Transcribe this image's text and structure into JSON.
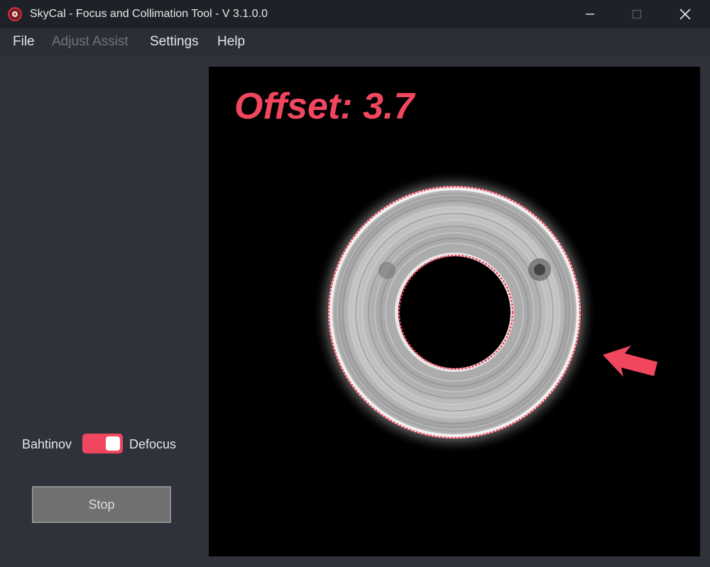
{
  "window": {
    "title": "SkyCal - Focus and Collimation Tool - V 3.1.0.0",
    "controls": {
      "minimize_icon": "minimize-icon",
      "maximize_icon": "maximize-icon",
      "close_icon": "close-icon"
    }
  },
  "menu": {
    "items": [
      {
        "label": "File",
        "enabled": true
      },
      {
        "label": "Adjust Assist",
        "enabled": false
      },
      {
        "label": "Settings",
        "enabled": true
      },
      {
        "label": "Help",
        "enabled": true
      }
    ]
  },
  "mode_toggle": {
    "left_label": "Bahtinov",
    "right_label": "Defocus",
    "selected": "Defocus"
  },
  "stop_button": {
    "label": "Stop"
  },
  "viewport": {
    "offset_label": "Offset:",
    "offset_value": "3.7",
    "image": "defocused-star-donut",
    "indicator": "arrow-icon"
  },
  "colors": {
    "accent": "#f0475f",
    "titlebar": "#1f2128",
    "panel": "#2f323b",
    "button": "#707070"
  }
}
